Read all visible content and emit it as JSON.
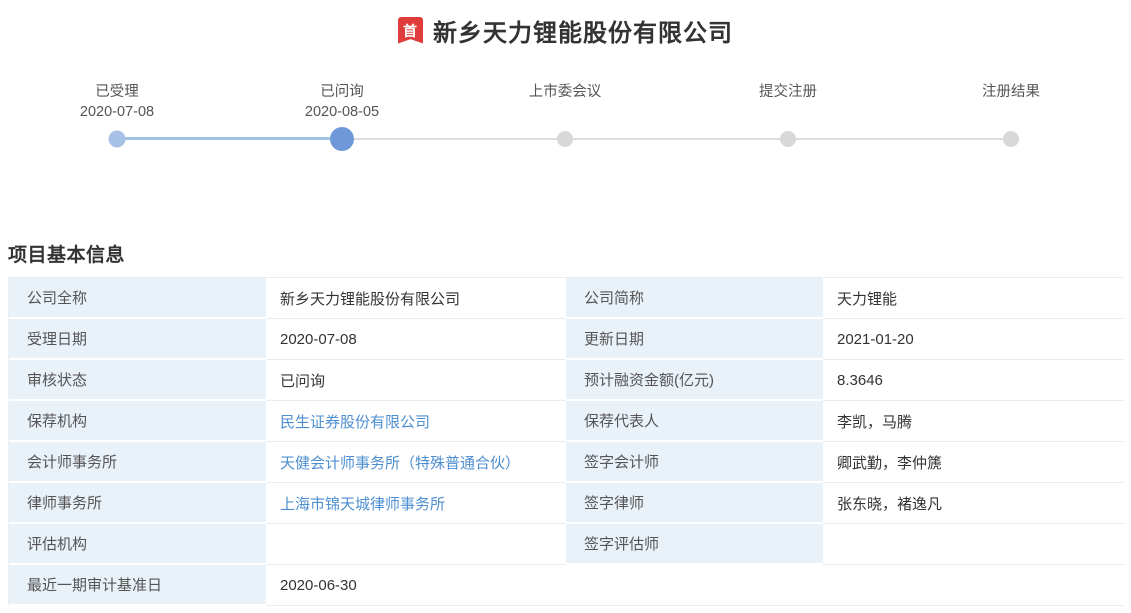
{
  "header": {
    "badge": "首",
    "title": "新乡天力锂能股份有限公司"
  },
  "stepper": {
    "steps": [
      {
        "label": "已受理",
        "date": "2020-07-08",
        "state": "done"
      },
      {
        "label": "已问询",
        "date": "2020-08-05",
        "state": "active"
      },
      {
        "label": "上市委会议",
        "date": "",
        "state": "pending"
      },
      {
        "label": "提交注册",
        "date": "",
        "state": "pending"
      },
      {
        "label": "注册结果",
        "date": "",
        "state": "pending"
      }
    ]
  },
  "section": {
    "title": "项目基本信息"
  },
  "table": {
    "rows": [
      {
        "cells": [
          {
            "type": "label",
            "text": "公司全称"
          },
          {
            "type": "value",
            "text": "新乡天力锂能股份有限公司"
          },
          {
            "type": "label",
            "text": "公司简称"
          },
          {
            "type": "value",
            "text": "天力锂能"
          }
        ]
      },
      {
        "cells": [
          {
            "type": "label",
            "text": "受理日期"
          },
          {
            "type": "value",
            "text": "2020-07-08"
          },
          {
            "type": "label",
            "text": "更新日期"
          },
          {
            "type": "value",
            "text": "2021-01-20"
          }
        ]
      },
      {
        "cells": [
          {
            "type": "label",
            "text": "审核状态"
          },
          {
            "type": "value",
            "text": "已问询"
          },
          {
            "type": "label",
            "text": "预计融资金额(亿元)"
          },
          {
            "type": "value",
            "text": "8.3646"
          }
        ]
      },
      {
        "cells": [
          {
            "type": "label",
            "text": "保荐机构"
          },
          {
            "type": "link",
            "text": "民生证券股份有限公司"
          },
          {
            "type": "label",
            "text": "保荐代表人"
          },
          {
            "type": "value",
            "text": "李凯，马腾"
          }
        ]
      },
      {
        "cells": [
          {
            "type": "label",
            "text": "会计师事务所"
          },
          {
            "type": "link",
            "text": "天健会计师事务所（特殊普通合伙）"
          },
          {
            "type": "label",
            "text": "签字会计师"
          },
          {
            "type": "value",
            "text": "卿武勤，李仲篪"
          }
        ]
      },
      {
        "cells": [
          {
            "type": "label",
            "text": "律师事务所"
          },
          {
            "type": "link",
            "text": "上海市锦天城律师事务所"
          },
          {
            "type": "label",
            "text": "签字律师"
          },
          {
            "type": "value",
            "text": "张东晓，褚逸凡"
          }
        ]
      },
      {
        "cells": [
          {
            "type": "label",
            "text": "评估机构"
          },
          {
            "type": "value",
            "text": ""
          },
          {
            "type": "label",
            "text": "签字评估师"
          },
          {
            "type": "value",
            "text": ""
          }
        ]
      },
      {
        "cells": [
          {
            "type": "label",
            "text": "最近一期审计基准日"
          },
          {
            "type": "value",
            "text": "2020-06-30"
          },
          {
            "type": "blank",
            "text": ""
          },
          {
            "type": "blank",
            "text": ""
          }
        ]
      }
    ]
  },
  "colors": {
    "badge_red": "#e13c3c",
    "link_blue": "#4e8fd1",
    "label_cell_bg": "#e9f1f9",
    "dot_done": "#a7c2e6",
    "dot_active": "#6e98d9",
    "dot_pending": "#d8d8d8",
    "line_blue": "#a3c0e6",
    "line_gray": "#dcdcdc"
  }
}
